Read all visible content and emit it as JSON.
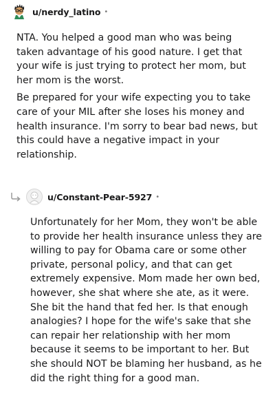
{
  "comments": [
    {
      "username": "u/nerdy_latino",
      "separator": "•",
      "avatar_icon": "nerdy-avatar-icon",
      "paragraphs": [
        "NTA. You helped a good man who was being taken advantage of his good nature. I get that your wife is just trying to protect her mom, but her mom is the worst.",
        "Be prepared for your wife expecting you to take care of your MIL after she loses his money and health insurance. I'm sorry to bear bad news, but this could have a negative impact in your relationship."
      ]
    },
    {
      "username": "u/Constant-Pear-5927",
      "separator": "•",
      "avatar_icon": "default-avatar-icon",
      "reply_icon": "reply-arrow-icon",
      "paragraphs": [
        "Unfortunately for her Mom, they won't be able to provide her health insurance unless they are willing to pay for Obama care or some other private, personal policy, and that can get extremely expensive. Mom made her own bed, however, she shat where she ate, as it were. She bit the hand that fed her. Is that enough analogies? I hope for the wife's sake that she can repair her relationship with her mom because it seems to be important to her. But she should NOT be blaming her husband, as he did the right thing for a good man."
      ]
    }
  ]
}
